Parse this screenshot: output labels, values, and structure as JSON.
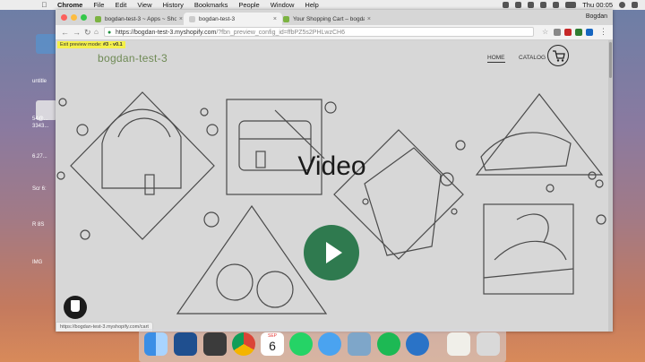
{
  "menubar": {
    "app": "Chrome",
    "items": [
      "File",
      "Edit",
      "View",
      "History",
      "Bookmarks",
      "People",
      "Window",
      "Help"
    ],
    "clock": "Thu 00:05"
  },
  "desktop": {
    "labels": [
      "untitle",
      "54@...",
      "3343...",
      "6.27...",
      "Scr 6:",
      "R 8S",
      "IMG"
    ]
  },
  "browser": {
    "profile": "Bogdan",
    "tabs": [
      {
        "title": "bogdan-test-3 ~ Apps ~ Shop",
        "active": false
      },
      {
        "title": "bogdan-test-3",
        "active": true
      },
      {
        "title": "Your Shopping Cart – bogdan",
        "active": false
      }
    ],
    "url_host": "https://bogdan-test-3.myshopify.com",
    "url_path": "/?fbn_preview_config_id=ffbPZ5s2PHLwzCH6",
    "status_url": "https://bogdan-test-3.myshopify.com/cart"
  },
  "store": {
    "preview_label": "Exit preview mode:",
    "preview_version": "#3 - v0.1",
    "logo": "bogdan-test-3",
    "nav": {
      "home": "HOME",
      "catalog": "CATALOG"
    },
    "video_title": "Video"
  },
  "colors": {
    "accent_green": "#2f7a4f",
    "logo_green": "#6f8a55",
    "preview_yellow": "#f4f04a"
  },
  "dock": {
    "apps": [
      "finder-icon",
      "vscode-icon",
      "sublime-icon",
      "chrome-icon",
      "calendar-icon",
      "whatsapp-icon",
      "messages-icon",
      "preview-icon",
      "spotify-icon",
      "quicktime-icon",
      "document-icon",
      "trash-icon"
    ],
    "calendar_day": "6",
    "calendar_month": "SEP"
  }
}
